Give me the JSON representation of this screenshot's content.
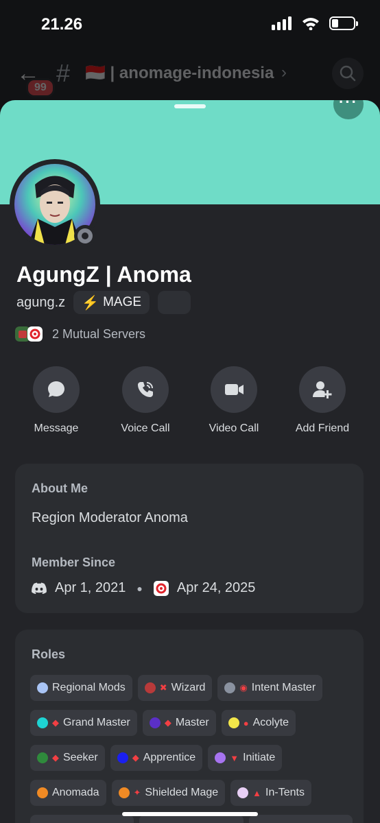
{
  "status_bar": {
    "time": "21.26",
    "battery_level": 0.3
  },
  "channel_header": {
    "unread_count": "99",
    "channel_name": "🇮🇩 | anomage-indonesia"
  },
  "profile": {
    "display_name": "AgungZ | Anoma",
    "username": "agung.z",
    "tag_label": "MAGE",
    "banner_color": "#6fdcc7",
    "status": "offline",
    "mutual_servers_text": "2 Mutual Servers"
  },
  "actions": [
    {
      "label": "Message",
      "icon": "message-bubble-icon"
    },
    {
      "label": "Voice Call",
      "icon": "phone-icon"
    },
    {
      "label": "Video Call",
      "icon": "video-camera-icon"
    },
    {
      "label": "Add Friend",
      "icon": "add-friend-icon"
    }
  ],
  "about": {
    "title": "About Me",
    "text": "Region Moderator Anoma",
    "member_since_title": "Member Since",
    "discord_date": "Apr 1, 2021",
    "server_date": "Apr 24, 2025"
  },
  "roles": {
    "title": "Roles",
    "rows": [
      [
        {
          "name": "Regional Mods",
          "color": "#a9c4f5",
          "emoji": ""
        },
        {
          "name": "Wizard",
          "color": "#b83a3a",
          "emoji": "✖"
        },
        {
          "name": "Intent Master",
          "color": "#8a92a0",
          "emoji": "◉"
        }
      ],
      [
        {
          "name": "Grand Master",
          "color": "#1ed3d3",
          "emoji": "◆"
        },
        {
          "name": "Master",
          "color": "#5b2fc7",
          "emoji": "◆"
        },
        {
          "name": "Acolyte",
          "color": "#f2e64a",
          "emoji": "●"
        }
      ],
      [
        {
          "name": "Seeker",
          "color": "#2f8a3c",
          "emoji": "◆"
        },
        {
          "name": "Apprentice",
          "color": "#1a1ff0",
          "emoji": "◆"
        },
        {
          "name": "Initiate",
          "color": "#a774f0",
          "emoji": "▼"
        }
      ],
      [
        {
          "name": "Anomada",
          "color": "#f08a24",
          "emoji": ""
        },
        {
          "name": "Shielded Mage",
          "color": "#f08a24",
          "emoji": "✦"
        },
        {
          "name": "In-Tents",
          "color": "#e8cff5",
          "emoji": "▲"
        }
      ]
    ]
  }
}
